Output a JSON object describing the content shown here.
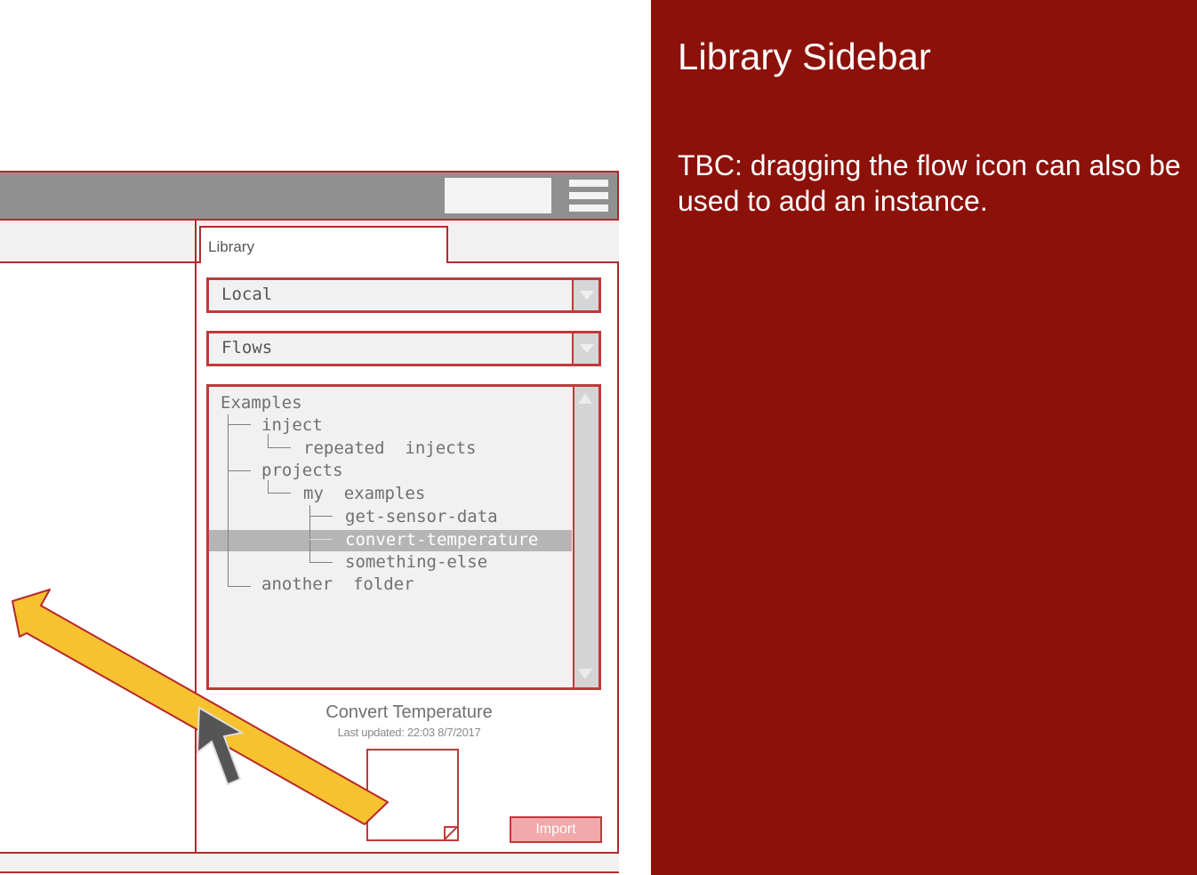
{
  "slide": {
    "title": "Library Sidebar",
    "note": "TBC: dragging the flow icon can also be used to add an instance."
  },
  "sidebar": {
    "tab_label": "Library",
    "source_select": "Local",
    "type_select": "Flows",
    "tree": [
      {
        "label": "Examples"
      },
      {
        "label": "inject"
      },
      {
        "label": "repeated  injects"
      },
      {
        "label": "projects"
      },
      {
        "label": "my  examples"
      },
      {
        "label": "get-sensor-data"
      },
      {
        "label": "convert-temperature"
      },
      {
        "label": "something-else"
      },
      {
        "label": "another  folder"
      }
    ],
    "selected_index": 6,
    "flow_title": "Convert Temperature",
    "flow_updated": "Last updated: 22:03 8/7/2017",
    "import_label": "Import"
  },
  "colors": {
    "panel": "#8b1109",
    "wire_border": "#c0393a",
    "arrow": "#f6c22f",
    "cursor": "#555555"
  },
  "icons": [
    "hamburger-menu-icon",
    "dropdown-arrow-icon",
    "scroll-up-icon",
    "scroll-down-icon",
    "flow-icon",
    "cursor-icon",
    "drag-arrow-icon"
  ]
}
